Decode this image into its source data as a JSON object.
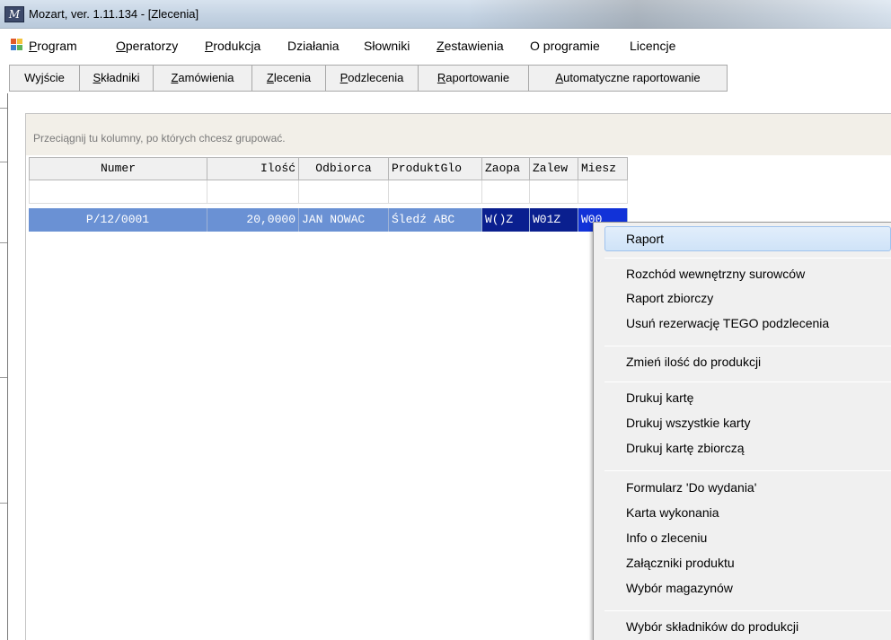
{
  "window": {
    "icon_text": "M",
    "title": "Mozart, ver. 1.11.134 - [Zlecenia]"
  },
  "menu": {
    "items": [
      "Program",
      "Operatorzy",
      "Produkcja",
      "Działania",
      "Słowniki",
      "Zestawienia",
      "O programie",
      "Licencje"
    ]
  },
  "toolbar": {
    "buttons": [
      "Wyjście",
      "Składniki",
      "Zamówienia",
      "Zlecenia",
      "Podzlecenia",
      "Raportowanie",
      "Automatyczne raportowanie"
    ]
  },
  "grid": {
    "group_hint": "Przeciągnij tu kolumny, po których chcesz grupować.",
    "columns": [
      "Numer",
      "Ilość",
      "Odbiorca",
      "ProduktGlo",
      "Zaopa",
      "Zalew",
      "Miesz"
    ],
    "rows": [
      [
        "P/12/0001",
        "20,0000",
        "JAN NOWAC",
        "Śledź ABC",
        "W()Z",
        "W01Z",
        "W00"
      ]
    ]
  },
  "context_menu": {
    "items": [
      "Raport",
      "Rozchód wewnętrzny surowców",
      "Raport zbiorczy",
      "Usuń rezerwację TEGO podzlecenia",
      "Zmień ilość do produkcji",
      "Drukuj kartę",
      "Drukuj wszystkie karty",
      "Drukuj kartę zbiorczą",
      "Formularz 'Do wydania'",
      "Karta wykonania",
      "Info o zleceniu",
      "Załączniki produktu",
      "Wybór magazynów",
      "Wybór składników do produkcji"
    ],
    "highlighted": "Raport"
  },
  "colors": {
    "selection": "#6a91d4",
    "selected_cell_dark": "#0a1f8f",
    "selected_cell_bright": "#1132d8",
    "menu_highlight": "#cfe3f8"
  }
}
